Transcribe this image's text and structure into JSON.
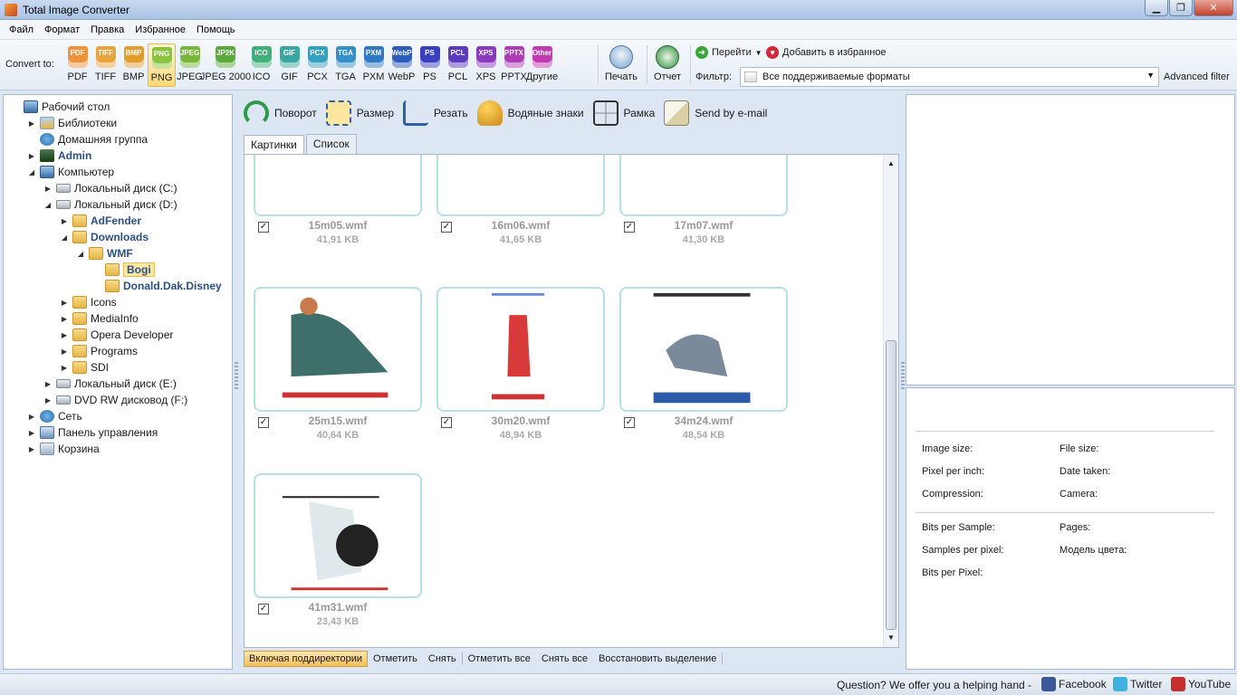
{
  "window": {
    "title": "Total Image Converter"
  },
  "menu": [
    "Файл",
    "Формат",
    "Правка",
    "Избранное",
    "Помощь"
  ],
  "toolbar": {
    "convert_to": "Convert to:",
    "formats": [
      {
        "label": "PDF",
        "tag": "PDF",
        "color": "#f0913c"
      },
      {
        "label": "TIFF",
        "tag": "TIFF",
        "color": "#e8a33a"
      },
      {
        "label": "BMP",
        "tag": "BMP",
        "color": "#e39c2f"
      },
      {
        "label": "PNG",
        "tag": "PNG",
        "color": "#8ac43f",
        "active": true
      },
      {
        "label": "JPEG",
        "tag": "JPEG",
        "color": "#77b83a"
      },
      {
        "label": "JPEG 2000",
        "tag": "JP2K",
        "color": "#5aab3a"
      },
      {
        "label": "ICO",
        "tag": "ICO",
        "color": "#3fb07a"
      },
      {
        "label": "GIF",
        "tag": "GIF",
        "color": "#3aa8a0"
      },
      {
        "label": "PCX",
        "tag": "PCX",
        "color": "#35a0c0"
      },
      {
        "label": "TGA",
        "tag": "TGA",
        "color": "#3590c8"
      },
      {
        "label": "PXM",
        "tag": "PXM",
        "color": "#2f78c4"
      },
      {
        "label": "WebP",
        "tag": "WebP",
        "color": "#2d5cbf"
      },
      {
        "label": "PS",
        "tag": "PS",
        "color": "#3a3fbf"
      },
      {
        "label": "PCL",
        "tag": "PCL",
        "color": "#5a3abf"
      },
      {
        "label": "XPS",
        "tag": "XPS",
        "color": "#8a3abf"
      },
      {
        "label": "PPTX",
        "tag": "PPTX",
        "color": "#b03ab8"
      },
      {
        "label": "Другие",
        "tag": "Other",
        "color": "#c33ab0"
      }
    ],
    "print": "Печать",
    "report": "Отчет",
    "goto": "Перейти",
    "add_fav": "Добавить в избранное",
    "filter_label": "Фильтр:",
    "filter_value": "Все поддерживаемые форматы",
    "advanced_filter": "Advanced filter"
  },
  "tree": [
    {
      "label": "Рабочий стол",
      "icon": "desktop-icon",
      "level": 0,
      "twisty": ""
    },
    {
      "label": "Библиотеки",
      "icon": "library-icon",
      "level": 1,
      "twisty": "▶"
    },
    {
      "label": "Домашняя группа",
      "icon": "homegroup-icon",
      "level": 1,
      "twisty": ""
    },
    {
      "label": "Admin",
      "icon": "user-icon",
      "level": 1,
      "twisty": "▶",
      "bold": true
    },
    {
      "label": "Компьютер",
      "icon": "computer-icon",
      "level": 1,
      "twisty": "◢"
    },
    {
      "label": "Локальный диск (C:)",
      "icon": "drive-icon",
      "level": 2,
      "twisty": "▶"
    },
    {
      "label": "Локальный диск (D:)",
      "icon": "drive-icon",
      "level": 2,
      "twisty": "◢"
    },
    {
      "label": "AdFender",
      "icon": "folder-icon",
      "level": 3,
      "twisty": "▶",
      "bold": true
    },
    {
      "label": "Downloads",
      "icon": "folder-icon",
      "level": 3,
      "twisty": "◢",
      "bold": true
    },
    {
      "label": "WMF",
      "icon": "folder-icon",
      "level": 4,
      "twisty": "◢",
      "bold": true
    },
    {
      "label": "Bogi",
      "icon": "folder-icon",
      "level": 5,
      "twisty": "",
      "bold": true,
      "selected": true
    },
    {
      "label": "Donald.Dak.Disney",
      "icon": "folder-icon",
      "level": 5,
      "twisty": "",
      "bold": true
    },
    {
      "label": "Icons",
      "icon": "folder-icon",
      "level": 3,
      "twisty": "▶"
    },
    {
      "label": "MediaInfo",
      "icon": "folder-icon",
      "level": 3,
      "twisty": "▶"
    },
    {
      "label": "Opera Developer",
      "icon": "folder-icon",
      "level": 3,
      "twisty": "▶"
    },
    {
      "label": "Programs",
      "icon": "folder-icon",
      "level": 3,
      "twisty": "▶"
    },
    {
      "label": "SDI",
      "icon": "folder-icon",
      "level": 3,
      "twisty": "▶"
    },
    {
      "label": "Локальный диск (E:)",
      "icon": "drive-icon",
      "level": 2,
      "twisty": "▶"
    },
    {
      "label": "DVD RW дисковод (F:)",
      "icon": "dvd-icon",
      "level": 2,
      "twisty": "▶"
    },
    {
      "label": "Сеть",
      "icon": "network-icon",
      "level": 1,
      "twisty": "▶"
    },
    {
      "label": "Панель управления",
      "icon": "control-panel-icon",
      "level": 1,
      "twisty": "▶"
    },
    {
      "label": "Корзина",
      "icon": "recycle-bin-icon",
      "level": 1,
      "twisty": "▶"
    }
  ],
  "actions": [
    {
      "label": "Поворот",
      "icon": "rotate-icon"
    },
    {
      "label": "Размер",
      "icon": "resize-icon"
    },
    {
      "label": "Резать",
      "icon": "crop-icon"
    },
    {
      "label": "Водяные знаки",
      "icon": "watermark-icon"
    },
    {
      "label": "Рамка",
      "icon": "frame-icon"
    },
    {
      "label": "Send by e-mail",
      "icon": "email-icon"
    }
  ],
  "tabs": [
    "Картинки",
    "Список"
  ],
  "files": [
    {
      "name": "15m05.wmf",
      "size": "41,91 KB"
    },
    {
      "name": "16m06.wmf",
      "size": "41,65 KB"
    },
    {
      "name": "17m07.wmf",
      "size": "41,30 KB"
    },
    {
      "name": "25m15.wmf",
      "size": "40,64 KB"
    },
    {
      "name": "30m20.wmf",
      "size": "48,94 KB"
    },
    {
      "name": "34m24.wmf",
      "size": "48,54 KB"
    },
    {
      "name": "41m31.wmf",
      "size": "23,43 KB"
    }
  ],
  "bottom": {
    "include_subdirs": "Включая поддиректории",
    "check": "Отметить",
    "uncheck": "Снять",
    "check_all": "Отметить все",
    "uncheck_all": "Снять все",
    "restore": "Восстановить выделение"
  },
  "info": {
    "image_size": "Image size:",
    "file_size": "File size:",
    "ppi": "Pixel per inch:",
    "date_taken": "Date taken:",
    "compression": "Compression:",
    "camera": "Camera:",
    "bps": "Bits per Sample:",
    "pages": "Pages:",
    "spp": "Samples per pixel:",
    "color_model": "Модель цвета:",
    "bpp": "Bits per Pixel:"
  },
  "status": {
    "question": "Question? We offer you a helping hand -",
    "facebook": "Facebook",
    "twitter": "Twitter",
    "youtube": "YouTube"
  }
}
